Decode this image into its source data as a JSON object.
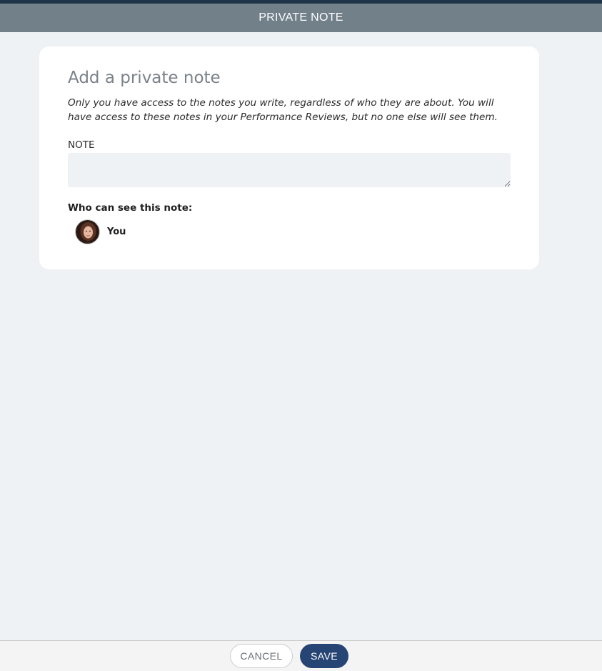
{
  "header": {
    "title": "PRIVATE NOTE"
  },
  "card": {
    "title": "Add a private note",
    "description": "Only you have access to the notes you write, regardless of who they are about. You will have access to these notes in your Performance Reviews, but no one else will see them.",
    "note_label": "NOTE",
    "note_value": "",
    "who_label": "Who can see this note:",
    "viewers": [
      {
        "name": "You",
        "icon": "user-avatar"
      }
    ]
  },
  "footer": {
    "cancel_label": "CANCEL",
    "save_label": "SAVE"
  },
  "colors": {
    "header_bg": "#718089",
    "page_bg": "#eff2f5",
    "save_bg": "#274574",
    "top_strip": "#1f3449"
  }
}
